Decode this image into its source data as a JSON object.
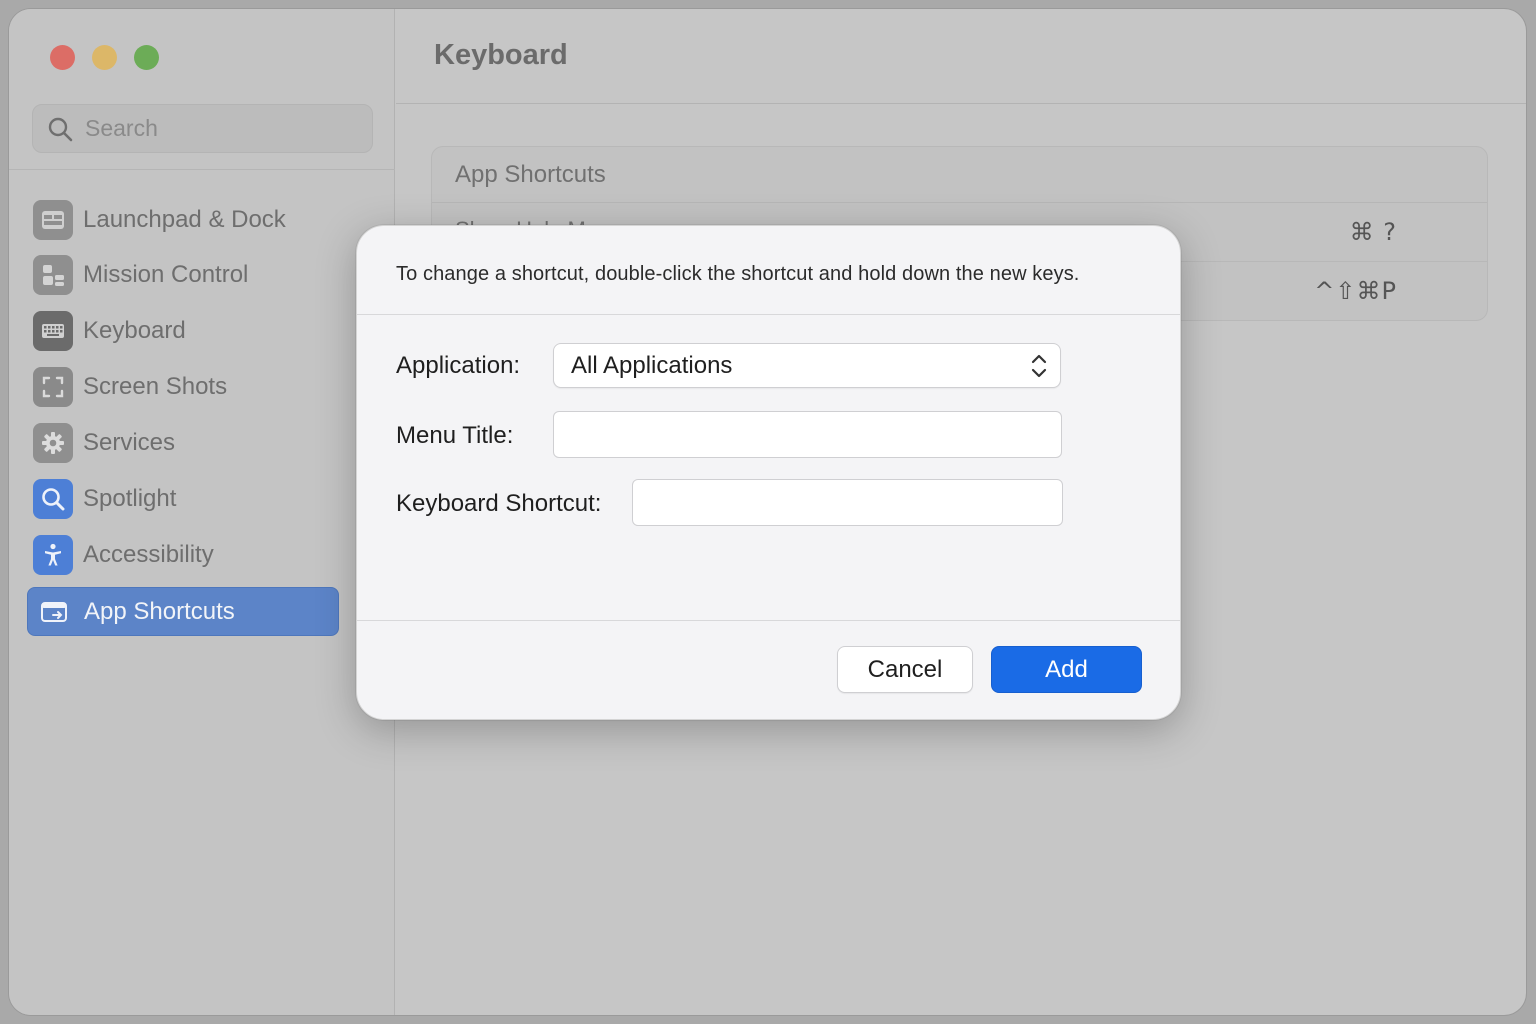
{
  "sidebar": {
    "search_placeholder": "Search",
    "items": [
      {
        "label": "Launchpad & Dock",
        "icon": "launchpad-dock-icon",
        "active": false
      },
      {
        "label": "Mission Control",
        "icon": "mission-control-icon",
        "active": false
      },
      {
        "label": "Keyboard",
        "icon": "keyboard-icon",
        "active": false
      },
      {
        "label": "Screen Shots",
        "icon": "screenshot-icon",
        "active": false
      },
      {
        "label": "Services",
        "icon": "gear-icon",
        "active": false
      },
      {
        "label": "Spotlight",
        "icon": "spotlight-search-icon",
        "active": false
      },
      {
        "label": "Accessibility",
        "icon": "accessibility-icon",
        "active": false
      },
      {
        "label": "App Shortcuts",
        "icon": "app-shortcuts-icon",
        "active": true
      }
    ]
  },
  "main": {
    "title": "Keyboard",
    "panel": {
      "header": "App Shortcuts",
      "rows": [
        {
          "name": "Show Help Menu",
          "keys": "⌘ ?"
        },
        {
          "name": "",
          "keys": "^⇧⌘P"
        }
      ]
    }
  },
  "dialog": {
    "message": "To change a shortcut, double-click the shortcut and hold down the new keys.",
    "application_label": "Application:",
    "application_value": "All Applications",
    "menu_title_label": "Menu Title:",
    "menu_title_value": "",
    "keyboard_shortcut_label": "Keyboard Shortcut:",
    "keyboard_shortcut_value": "",
    "cancel_label": "Cancel",
    "add_label": "Add"
  },
  "colors": {
    "accent": "#1a6be6",
    "sidebar_selected": "#5c84c8",
    "close": "#dc6d66",
    "minimize": "#dcb768",
    "zoom": "#6cac57"
  }
}
